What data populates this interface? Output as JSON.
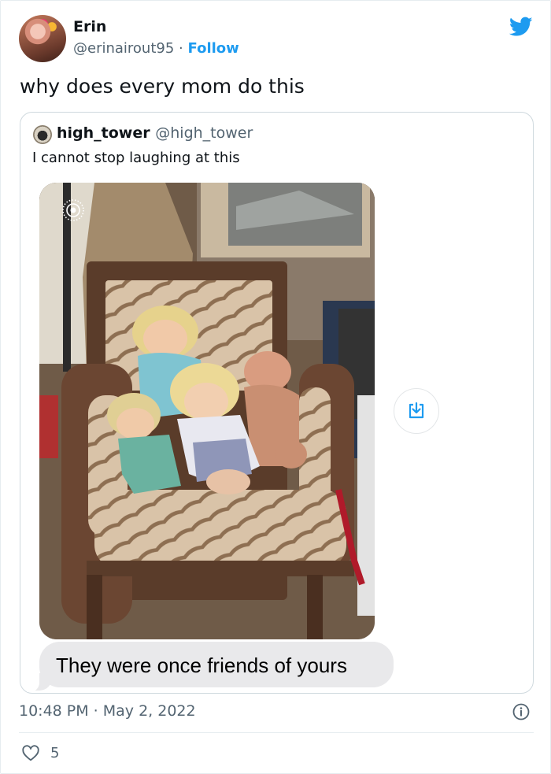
{
  "author": {
    "name": "Erin",
    "handle": "@erinairout95",
    "separator": "·",
    "follow_label": "Follow"
  },
  "tweet": {
    "text": "why does every mom do this",
    "timestamp": "10:48 PM · May 2, 2022",
    "like_count": "5"
  },
  "quoted_tweet": {
    "name": "high_tower",
    "handle": "@high_tower",
    "text": "I cannot stop laughing at this",
    "message_bubble": "They were once friends of yours"
  },
  "colors": {
    "accent": "#1d9bf0",
    "secondary_text": "#536471",
    "border": "#cfd9de"
  },
  "icons": [
    "twitter-bird-icon",
    "live-photo-icon",
    "download-icon",
    "info-icon",
    "heart-icon"
  ]
}
